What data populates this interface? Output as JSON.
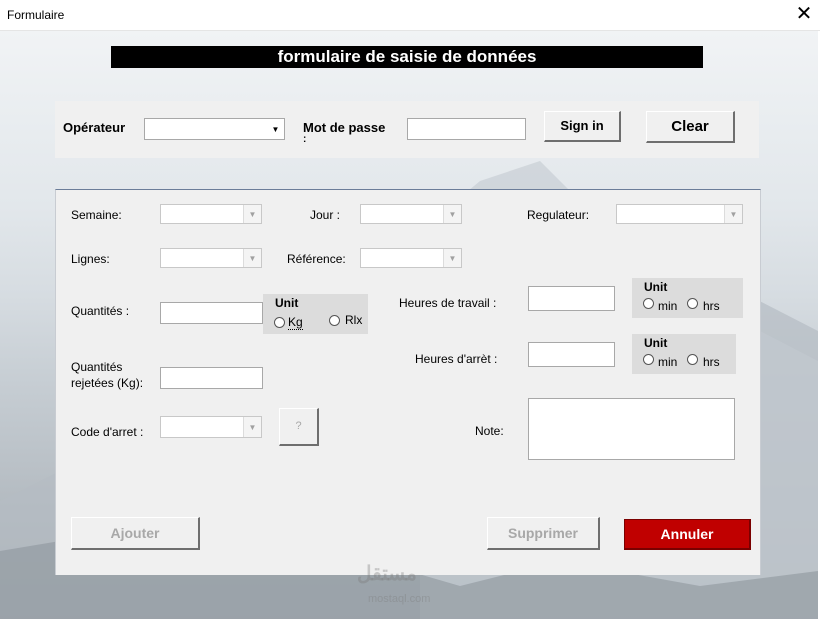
{
  "window": {
    "title": "Formulaire",
    "close_glyph": "✕"
  },
  "header": {
    "title": "formulaire de saisie de données"
  },
  "login": {
    "operator_label": "Opérateur",
    "password_label": "Mot de passe",
    "password_label_cont": ":",
    "operator_value": "",
    "password_value": "",
    "sign_in_label": "Sign in",
    "clear_label": "Clear"
  },
  "form": {
    "semaine_label": "Semaine:",
    "jour_label": "Jour :",
    "regulateur_label": "Regulateur:",
    "lignes_label": "Lignes:",
    "reference_label": "Référence:",
    "quantites_label": "Quantités :",
    "quantites_rejetees_label_1": "Quantités",
    "quantites_rejetees_label_2": "rejetées (Kg):",
    "code_arret_label": "Code d'arret :",
    "help_label": "?",
    "heures_travail_label": "Heures de travail :",
    "heures_arret_label": "Heures d'arrèt :",
    "note_label": "Note:",
    "unit_qty": {
      "title": "Unit",
      "opt1": "Kg",
      "opt2": "Rlx"
    },
    "unit_travail": {
      "title": "Unit",
      "opt1": "min",
      "opt2": "hrs"
    },
    "unit_arret": {
      "title": "Unit",
      "opt1": "min",
      "opt2": "hrs"
    }
  },
  "actions": {
    "ajouter_label": "Ajouter",
    "supprimer_label": "Supprimer",
    "annuler_label": "Annuler"
  },
  "watermark": {
    "text": "مستقل",
    "url": "mostaql.com"
  },
  "colors": {
    "header_bg": "#000000",
    "annuler_bg": "#c00000",
    "panel_bg": "#f0f0f0"
  },
  "icons": {
    "dropdown": "chevron-down-icon",
    "close": "close-icon"
  }
}
